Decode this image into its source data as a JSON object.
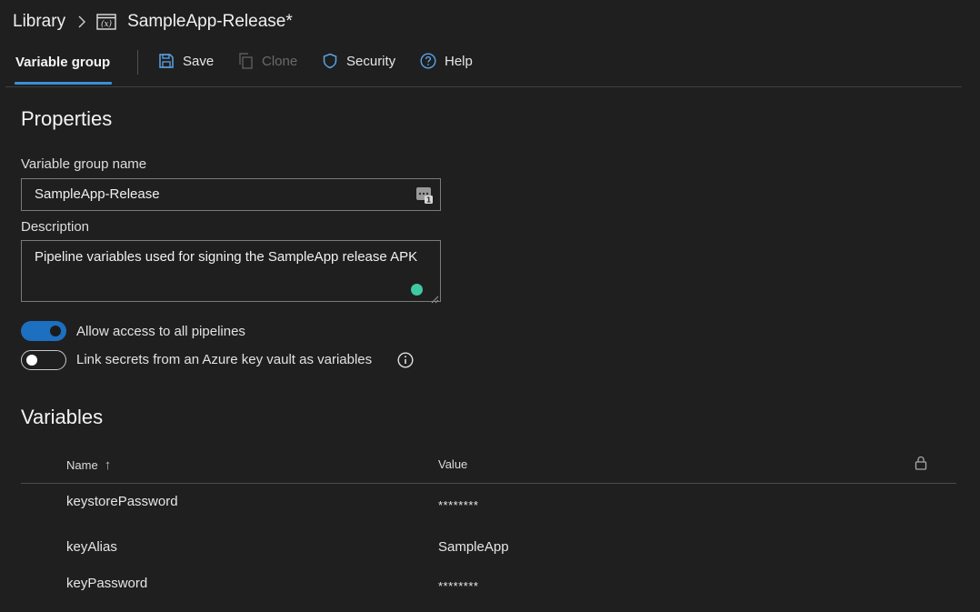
{
  "breadcrumb": {
    "root": "Library",
    "current": "SampleApp-Release*"
  },
  "toolbar": {
    "active_tab": "Variable group",
    "save": "Save",
    "clone": "Clone",
    "security": "Security",
    "help": "Help"
  },
  "properties": {
    "heading": "Properties",
    "name_label": "Variable group name",
    "name_value": "SampleApp-Release",
    "description_label": "Description",
    "description_value": "Pipeline variables used for signing the SampleApp release APK",
    "allow_access": {
      "label": "Allow access to all pipelines",
      "enabled": true
    },
    "link_secrets": {
      "label": "Link secrets from an Azure key vault as variables",
      "enabled": false
    }
  },
  "variables": {
    "heading": "Variables",
    "columns": {
      "name": "Name",
      "value": "Value"
    },
    "sort_indicator": "↑",
    "rows": [
      {
        "name": "keystorePassword",
        "value": "********"
      },
      {
        "name": "keyAlias",
        "value": "SampleApp"
      },
      {
        "name": "keyPassword",
        "value": "********"
      }
    ]
  },
  "colors": {
    "background": "#1f1f1f",
    "accent": "#1d6fc0",
    "tab_underline": "#3a8fd6",
    "status_dot": "#3ec9a2"
  },
  "icons": [
    "variable-group-icon",
    "save-icon",
    "clone-icon",
    "shield-icon",
    "help-icon",
    "info-icon",
    "lock-icon",
    "chevron-right-icon"
  ]
}
